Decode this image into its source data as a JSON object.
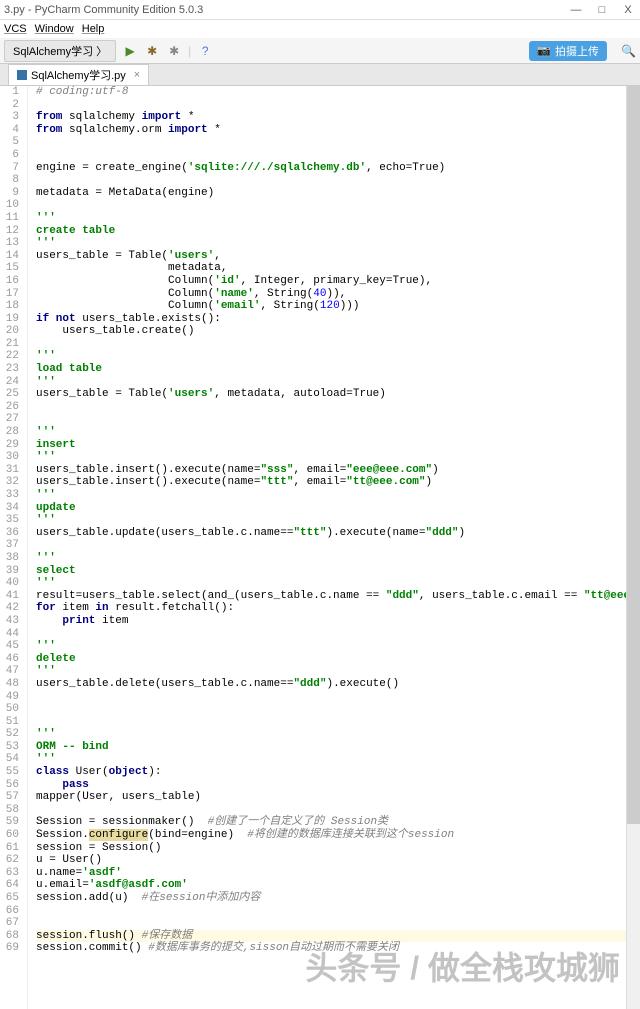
{
  "app": {
    "title": "3.py - PyCharm Community Edition 5.0.3"
  },
  "win_btns": {
    "min": "—",
    "max": "□",
    "close": "X"
  },
  "menu": [
    "VCS",
    "Window",
    "Help"
  ],
  "crumb": "SqlAlchemy学习 〉",
  "upload": "拍摄上传",
  "tab": {
    "name": "SqlAlchemy学习.py"
  },
  "lines": [
    {
      "n": 1,
      "t": [
        {
          "c": "cmt",
          "s": "# coding:utf-8"
        }
      ]
    },
    {
      "n": 2,
      "t": []
    },
    {
      "n": 3,
      "t": [
        {
          "c": "kw",
          "s": "from "
        },
        {
          "s": "sqlalchemy "
        },
        {
          "c": "kw",
          "s": "import "
        },
        {
          "s": "*"
        }
      ]
    },
    {
      "n": 4,
      "t": [
        {
          "c": "kw",
          "s": "from "
        },
        {
          "s": "sqlalchemy.orm "
        },
        {
          "c": "kw",
          "s": "import "
        },
        {
          "s": "*"
        }
      ]
    },
    {
      "n": 5,
      "t": []
    },
    {
      "n": 6,
      "t": []
    },
    {
      "n": 7,
      "t": [
        {
          "s": "engine = create_engine("
        },
        {
          "c": "str",
          "s": "'sqlite:///./sqlalchemy.db'"
        },
        {
          "s": ", "
        },
        {
          "s": "echo"
        },
        {
          "s": "="
        },
        {
          "s": "True)"
        }
      ]
    },
    {
      "n": 8,
      "t": []
    },
    {
      "n": 9,
      "t": [
        {
          "s": "metadata = MetaData(engine)"
        }
      ]
    },
    {
      "n": 10,
      "t": []
    },
    {
      "n": 11,
      "t": [
        {
          "c": "str",
          "s": "'''"
        }
      ]
    },
    {
      "n": 12,
      "t": [
        {
          "c": "str",
          "s": "create table"
        }
      ]
    },
    {
      "n": 13,
      "t": [
        {
          "c": "str",
          "s": "'''"
        }
      ]
    },
    {
      "n": 14,
      "t": [
        {
          "s": "users_table = Table("
        },
        {
          "c": "str",
          "s": "'users'"
        },
        {
          "s": ","
        }
      ]
    },
    {
      "n": 15,
      "t": [
        {
          "s": "                    metadata,"
        }
      ]
    },
    {
      "n": 16,
      "t": [
        {
          "s": "                    Column("
        },
        {
          "c": "str",
          "s": "'id'"
        },
        {
          "s": ", Integer, "
        },
        {
          "s": "primary_key"
        },
        {
          "s": "=True),"
        }
      ]
    },
    {
      "n": 17,
      "t": [
        {
          "s": "                    Column("
        },
        {
          "c": "str",
          "s": "'name'"
        },
        {
          "s": ", String("
        },
        {
          "c": "num",
          "s": "40"
        },
        {
          "s": ")),"
        }
      ]
    },
    {
      "n": 18,
      "t": [
        {
          "s": "                    Column("
        },
        {
          "c": "str",
          "s": "'email'"
        },
        {
          "s": ", String("
        },
        {
          "c": "num",
          "s": "120"
        },
        {
          "s": ")))"
        }
      ]
    },
    {
      "n": 19,
      "t": [
        {
          "c": "kw",
          "s": "if not "
        },
        {
          "s": "users_table.exists():"
        }
      ]
    },
    {
      "n": 20,
      "t": [
        {
          "s": "    users_table.create()"
        }
      ]
    },
    {
      "n": 21,
      "t": []
    },
    {
      "n": 22,
      "t": [
        {
          "c": "str",
          "s": "'''"
        }
      ]
    },
    {
      "n": 23,
      "t": [
        {
          "c": "str",
          "s": "load table"
        }
      ]
    },
    {
      "n": 24,
      "t": [
        {
          "c": "str",
          "s": "'''"
        }
      ]
    },
    {
      "n": 25,
      "t": [
        {
          "s": "users_table = Table("
        },
        {
          "c": "str",
          "s": "'users'"
        },
        {
          "s": ", metadata, "
        },
        {
          "s": "autoload"
        },
        {
          "s": "=True)"
        }
      ]
    },
    {
      "n": 26,
      "t": []
    },
    {
      "n": 27,
      "t": []
    },
    {
      "n": 28,
      "t": [
        {
          "c": "str",
          "s": "'''"
        }
      ]
    },
    {
      "n": 29,
      "t": [
        {
          "c": "str",
          "s": "insert"
        }
      ]
    },
    {
      "n": 30,
      "t": [
        {
          "c": "str",
          "s": "'''"
        }
      ]
    },
    {
      "n": 31,
      "t": [
        {
          "s": "users_table.insert().execute("
        },
        {
          "s": "name"
        },
        {
          "s": "="
        },
        {
          "c": "str",
          "s": "\"sss\""
        },
        {
          "s": ", "
        },
        {
          "s": "email"
        },
        {
          "s": "="
        },
        {
          "c": "str",
          "s": "\"eee@eee.com\""
        },
        {
          "s": ")"
        }
      ]
    },
    {
      "n": 32,
      "t": [
        {
          "s": "users_table.insert().execute("
        },
        {
          "s": "name"
        },
        {
          "s": "="
        },
        {
          "c": "str",
          "s": "\"ttt\""
        },
        {
          "s": ", "
        },
        {
          "s": "email"
        },
        {
          "s": "="
        },
        {
          "c": "str",
          "s": "\"tt@eee.com\""
        },
        {
          "s": ")"
        }
      ]
    },
    {
      "n": 33,
      "t": [
        {
          "c": "str",
          "s": "'''"
        }
      ]
    },
    {
      "n": 34,
      "t": [
        {
          "c": "str",
          "s": "update"
        }
      ]
    },
    {
      "n": 35,
      "t": [
        {
          "c": "str",
          "s": "'''"
        }
      ]
    },
    {
      "n": 36,
      "t": [
        {
          "s": "users_table.update(users_table.c.name=="
        },
        {
          "c": "str",
          "s": "\"ttt\""
        },
        {
          "s": ").execute("
        },
        {
          "s": "name"
        },
        {
          "s": "="
        },
        {
          "c": "str",
          "s": "\"ddd\""
        },
        {
          "s": ")"
        }
      ]
    },
    {
      "n": 37,
      "t": []
    },
    {
      "n": 38,
      "t": [
        {
          "c": "str",
          "s": "'''"
        }
      ]
    },
    {
      "n": 39,
      "t": [
        {
          "c": "str",
          "s": "select"
        }
      ]
    },
    {
      "n": 40,
      "t": [
        {
          "c": "str",
          "s": "'''"
        }
      ]
    },
    {
      "n": 41,
      "t": [
        {
          "s": "result=users_table.select(and_(users_table.c.name == "
        },
        {
          "c": "str",
          "s": "\"ddd\""
        },
        {
          "s": ", users_table.c.email == "
        },
        {
          "c": "str",
          "s": "\"tt@eee.com\""
        },
        {
          "s": ")).execute"
        }
      ]
    },
    {
      "n": 42,
      "t": [
        {
          "c": "kw",
          "s": "for "
        },
        {
          "s": "item "
        },
        {
          "c": "kw",
          "s": "in "
        },
        {
          "s": "result.fetchall():"
        }
      ]
    },
    {
      "n": 43,
      "t": [
        {
          "s": "    "
        },
        {
          "c": "kw",
          "s": "print "
        },
        {
          "s": "item"
        }
      ]
    },
    {
      "n": 44,
      "t": []
    },
    {
      "n": 45,
      "t": [
        {
          "c": "str",
          "s": "'''"
        }
      ]
    },
    {
      "n": 46,
      "t": [
        {
          "c": "str",
          "s": "delete"
        }
      ]
    },
    {
      "n": 47,
      "t": [
        {
          "c": "str",
          "s": "'''"
        }
      ]
    },
    {
      "n": 48,
      "t": [
        {
          "s": "users_table.delete(users_table.c.name=="
        },
        {
          "c": "str",
          "s": "\"ddd\""
        },
        {
          "s": ").execute()"
        }
      ]
    },
    {
      "n": 49,
      "t": []
    },
    {
      "n": 50,
      "t": []
    },
    {
      "n": 51,
      "t": []
    },
    {
      "n": 52,
      "t": [
        {
          "c": "str",
          "s": "'''"
        }
      ]
    },
    {
      "n": 53,
      "t": [
        {
          "c": "str",
          "s": "ORM -- bind"
        }
      ]
    },
    {
      "n": 54,
      "t": [
        {
          "c": "str",
          "s": "'''"
        }
      ]
    },
    {
      "n": 55,
      "t": [
        {
          "c": "kw",
          "s": "class "
        },
        {
          "s": "User("
        },
        {
          "c": "kw",
          "s": "object"
        },
        {
          "s": "):"
        }
      ]
    },
    {
      "n": 56,
      "t": [
        {
          "s": "    "
        },
        {
          "c": "kw",
          "s": "pass"
        }
      ]
    },
    {
      "n": 57,
      "t": [
        {
          "s": "mapper(User, users_table)"
        }
      ]
    },
    {
      "n": 58,
      "t": []
    },
    {
      "n": 59,
      "t": [
        {
          "s": "Session = sessionmaker()  "
        },
        {
          "c": "cmt",
          "s": "#创建了一个自定义了的 Session类"
        }
      ]
    },
    {
      "n": 60,
      "t": [
        {
          "s": "Session."
        },
        {
          "hl": true,
          "s": "configure"
        },
        {
          "s": "("
        },
        {
          "s": "bind"
        },
        {
          "s": "=engine)  "
        },
        {
          "c": "cmt",
          "s": "#将创建的数据库连接关联到这个session"
        }
      ]
    },
    {
      "n": 61,
      "t": [
        {
          "s": "session = Session()"
        }
      ]
    },
    {
      "n": 62,
      "t": [
        {
          "s": "u = User()"
        }
      ]
    },
    {
      "n": 63,
      "t": [
        {
          "s": "u.name="
        },
        {
          "c": "str",
          "s": "'asdf'"
        }
      ]
    },
    {
      "n": 64,
      "t": [
        {
          "s": "u.email="
        },
        {
          "c": "str",
          "s": "'asdf@asdf.com'"
        }
      ]
    },
    {
      "n": 65,
      "t": [
        {
          "s": "session.add(u)  "
        },
        {
          "c": "cmt",
          "s": "#在session中添加内容"
        }
      ]
    },
    {
      "n": 66,
      "t": []
    },
    {
      "n": 67,
      "t": []
    },
    {
      "n": 68,
      "hl": true,
      "t": [
        {
          "s": "session.flush() "
        },
        {
          "c": "cmt",
          "s": "#保存数据"
        }
      ]
    },
    {
      "n": 69,
      "t": [
        {
          "s": "session.commit() "
        },
        {
          "c": "cmt",
          "s": "#数据库事务的提交,sisson自动过期而不需要关闭"
        }
      ]
    }
  ],
  "watermark": "头条号 / 做全栈攻城狮"
}
